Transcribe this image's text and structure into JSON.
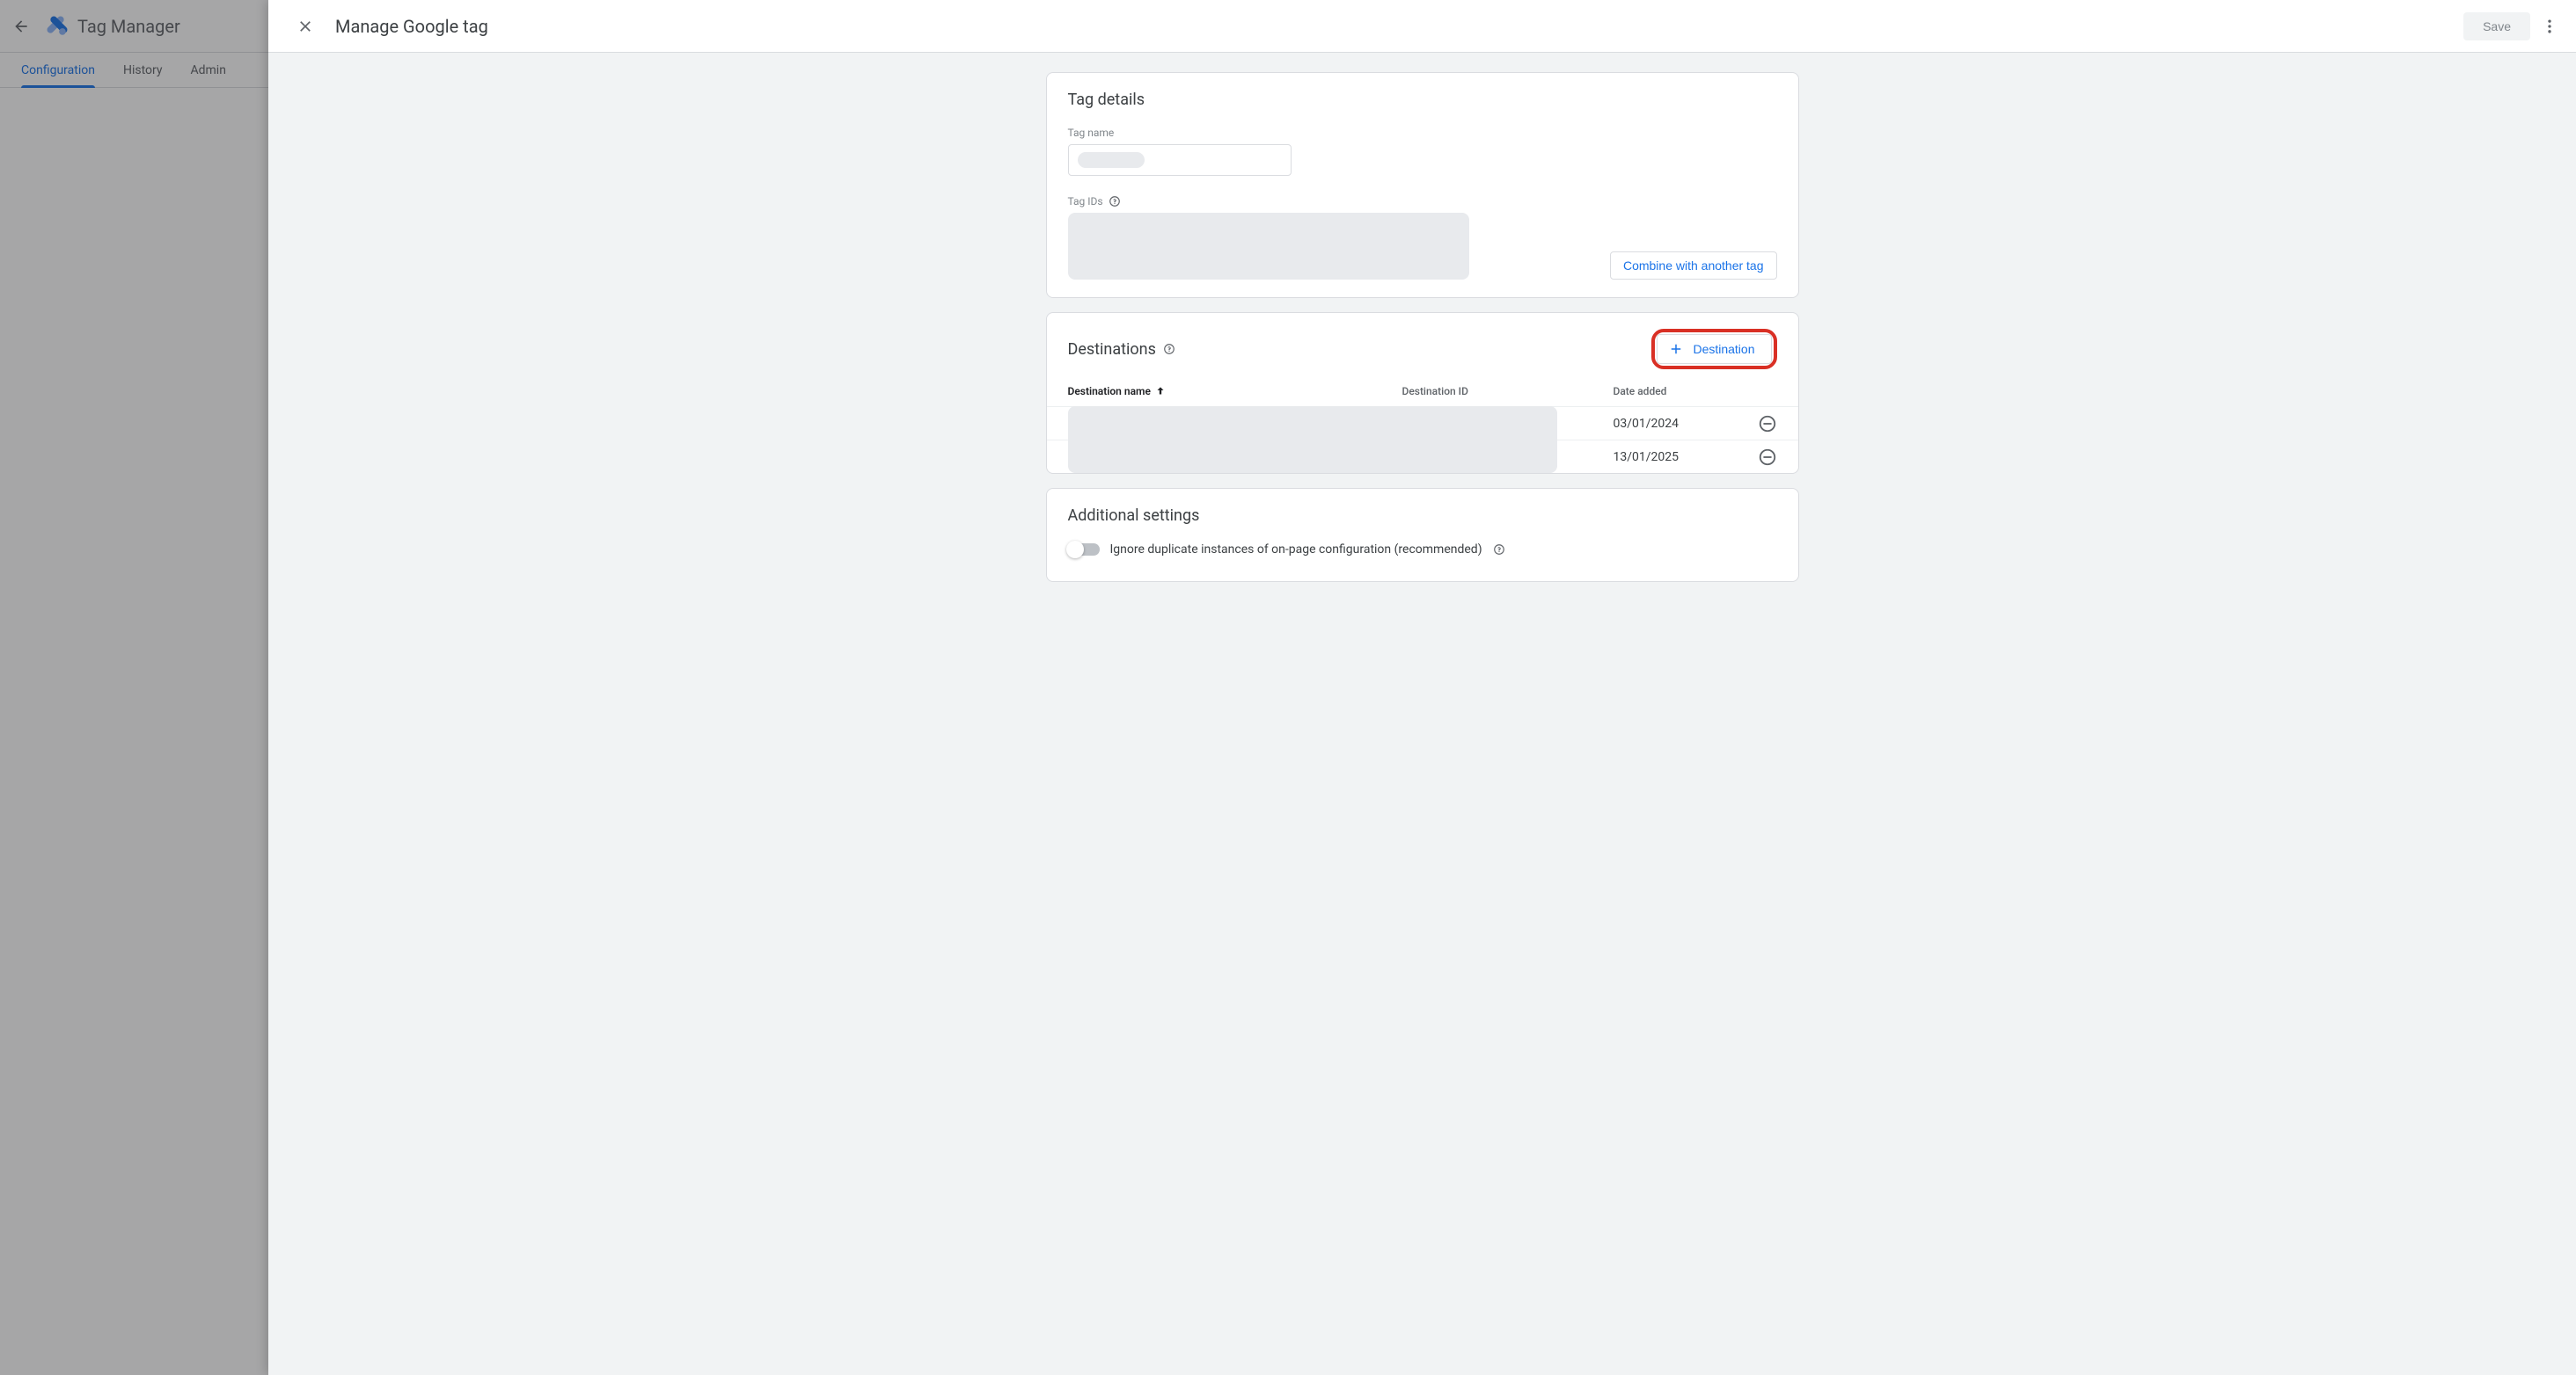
{
  "bg": {
    "title": "Tag Manager",
    "tabs": [
      "Configuration",
      "History",
      "Admin"
    ],
    "active_tab": 0
  },
  "panel": {
    "title": "Manage Google tag",
    "save_label": "Save"
  },
  "tag_details": {
    "title": "Tag details",
    "name_label": "Tag name",
    "ids_label": "Tag IDs",
    "combine_label": "Combine with another tag"
  },
  "destinations": {
    "title": "Destinations",
    "add_label": "Destination",
    "columns": {
      "name": "Destination name",
      "id": "Destination ID",
      "date": "Date added"
    },
    "rows": [
      {
        "date": "03/01/2024"
      },
      {
        "date": "13/01/2025"
      }
    ]
  },
  "additional": {
    "title": "Additional settings",
    "toggle_label": "Ignore duplicate instances of on-page configuration (recommended)"
  }
}
